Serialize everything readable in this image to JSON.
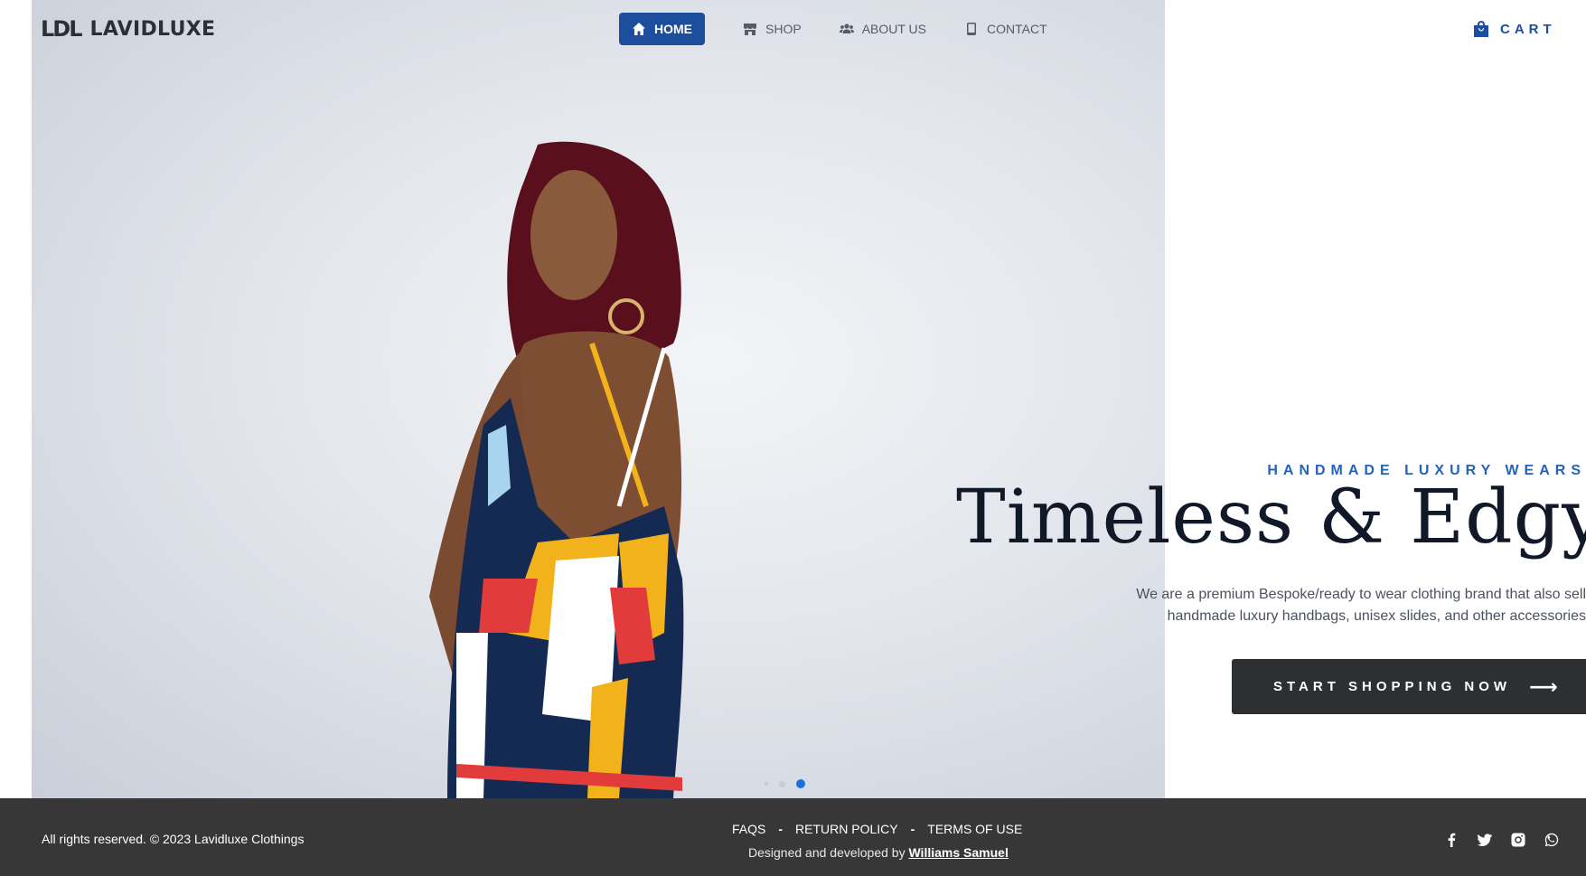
{
  "header": {
    "logo_mark": "LDL",
    "logo_text": "LAVIDLUXE",
    "nav": [
      {
        "label": "HOME",
        "icon": "home-icon",
        "active": true
      },
      {
        "label": "SHOP",
        "icon": "store-icon",
        "active": false
      },
      {
        "label": "ABOUT US",
        "icon": "users-icon",
        "active": false
      },
      {
        "label": "CONTACT",
        "icon": "phone-icon",
        "active": false
      }
    ],
    "cart_label": "CART"
  },
  "hero": {
    "tagline": "HANDMADE LUXURY WEARS",
    "headline": "Timeless & Edgy",
    "description": "We are a premium Bespoke/ready to wear clothing brand that also sell handmade luxury handbags, unisex slides, and other accessories",
    "cta_label": "START SHOPPING NOW",
    "cta_arrow": "⟶",
    "carousel": {
      "total": 3,
      "active_index": 2
    }
  },
  "footer": {
    "copyright": "All rights reserved. © 2023 Lavidluxe Clothings",
    "links": [
      "FAQS",
      "RETURN POLICY",
      "TERMS OF USE"
    ],
    "separator": "-",
    "credit_prefix": "Designed and developed by",
    "credit_name": "Williams Samuel",
    "social": [
      "facebook-icon",
      "twitter-icon",
      "instagram-icon",
      "whatsapp-icon"
    ]
  },
  "colors": {
    "accent": "#1d4e9e",
    "tagline": "#2563b8",
    "cta_bg": "#2d3033",
    "footer_bg": "#373737",
    "dot_active": "#1d6fe0"
  }
}
